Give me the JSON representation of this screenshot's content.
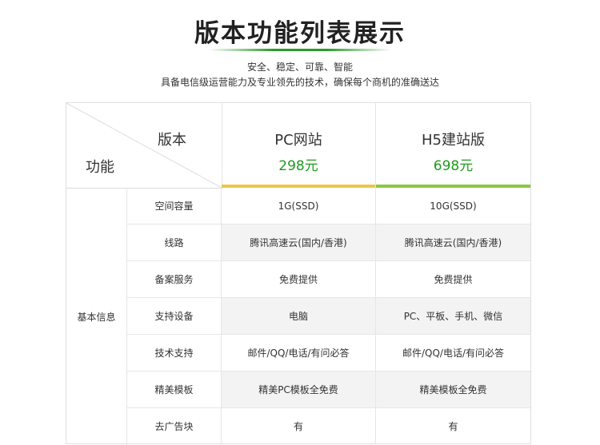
{
  "header": {
    "title": "版本功能列表展示",
    "subtitle_line1": "安全、稳定、可靠、智能",
    "subtitle_line2": "具备电信级运营能力及专业领先的技术，确保每个商机的准确送达"
  },
  "table": {
    "corner_version_label": "版本",
    "corner_feature_label": "功能",
    "group_label": "基本信息",
    "plans": [
      {
        "name": "PC网站",
        "price": "298元",
        "bar_color": "#e8c84a"
      },
      {
        "name": "H5建站版",
        "price": "698元",
        "bar_color": "#8cc63f"
      }
    ],
    "rows": [
      {
        "feature": "空间容量",
        "pc": "1G(SSD)",
        "h5": "10G(SSD)"
      },
      {
        "feature": "线路",
        "pc": "腾讯高速云(国内/香港)",
        "h5": "腾讯高速云(国内/香港)"
      },
      {
        "feature": "备案服务",
        "pc": "免费提供",
        "h5": "免费提供"
      },
      {
        "feature": "支持设备",
        "pc": "电脑",
        "h5": "PC、平板、手机、微信"
      },
      {
        "feature": "技术支持",
        "pc": "邮件/QQ/电话/有问必答",
        "h5": "邮件/QQ/电话/有问必答"
      },
      {
        "feature": "精美模板",
        "pc": "精美PC模板全免费",
        "h5": "精美模板全免费"
      },
      {
        "feature": "去广告块",
        "pc": "有",
        "h5": "有"
      }
    ]
  }
}
